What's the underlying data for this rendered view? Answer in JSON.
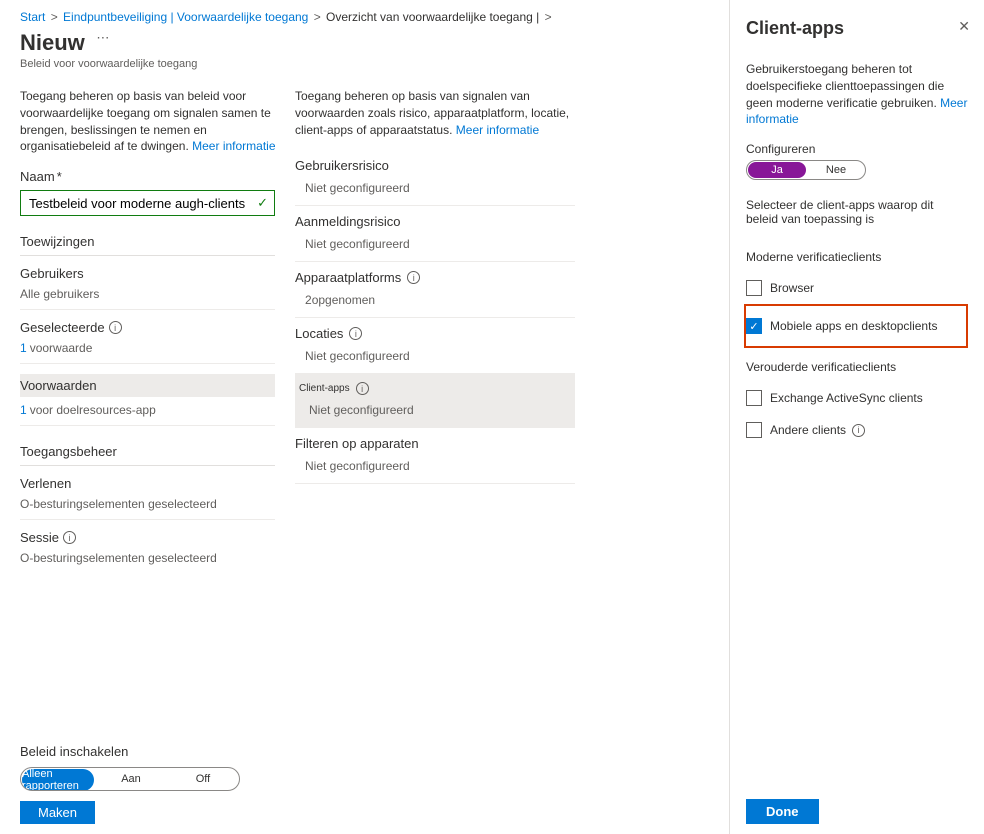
{
  "breadcrumb": {
    "items": [
      "Start",
      "Eindpuntbeveiliging | Voorwaardelijke toegang",
      "Overzicht van voorwaardelijke toegang |"
    ]
  },
  "pageTitle": "Nieuw",
  "subtitle": "Beleid voor voorwaardelijke toegang",
  "col1": {
    "desc": "Toegang beheren op basis van beleid voor voorwaardelijke toegang om signalen samen te brengen, beslissingen te nemen en organisatiebeleid af te dwingen.",
    "more": "Meer informatie",
    "nameLabel": "Naam",
    "nameValue": "Testbeleid voor moderne augh-clients",
    "assignmentsHead": "Toewijzingen",
    "usersLabel": "Gebruikers",
    "usersVal": "Alle gebruikers",
    "selectedLabel": "Geselecteerde",
    "selectedVal": "voorwaarde",
    "selectedNum": "1",
    "conditionsLabel": "Voorwaarden",
    "conditionsVal": "voor doelresources-app",
    "conditionsNum": "1",
    "accessHead": "Toegangsbeheer",
    "grantLabel": "Verlenen",
    "grantVal": "O-besturingselementen geselecteerd",
    "sessionLabel": "Sessie",
    "sessionVal": "O-besturingselementen geselecteerd"
  },
  "col2": {
    "desc": "Toegang beheren op basis van signalen van voorwaarden zoals risico, apparaatplatform, locatie, client-apps of apparaatstatus.",
    "more": "Meer informatie",
    "blocks": [
      {
        "label": "Gebruikersrisico",
        "val": "Niet geconfigureerd"
      },
      {
        "label": "Aanmeldingsrisico",
        "val": "Niet geconfigureerd"
      },
      {
        "label": "Apparaatplatforms",
        "val": "opgenomen",
        "num": "2",
        "info": true
      },
      {
        "label": "Locaties",
        "val": "Niet geconfigureerd",
        "info": true
      },
      {
        "label": "Client-apps",
        "val": "Niet geconfigureerd",
        "info": true,
        "selected": true
      },
      {
        "label": "Filteren op apparaten",
        "val": "Niet geconfigureerd"
      }
    ]
  },
  "footer": {
    "label": "Beleid inschakelen",
    "opts": [
      "Alleen rapporteren",
      "Aan",
      "Off"
    ],
    "create": "Maken"
  },
  "panel": {
    "title": "Client-apps",
    "desc": "Gebruikerstoegang beheren tot doelspecifieke clienttoepassingen die geen moderne verificatie gebruiken.",
    "more": "Meer informatie",
    "configLabel": "Configureren",
    "configOpts": [
      "Ja",
      "Nee"
    ],
    "selectText": "Selecteer de client-apps waarop dit beleid van toepassing is",
    "group1": "Moderne verificatieclients",
    "cb1": "Browser",
    "cb2": "Mobiele apps en desktopclients",
    "group2": "Verouderde verificatieclients",
    "cb3": "Exchange ActiveSync clients",
    "cb4": "Andere clients",
    "done": "Done"
  }
}
